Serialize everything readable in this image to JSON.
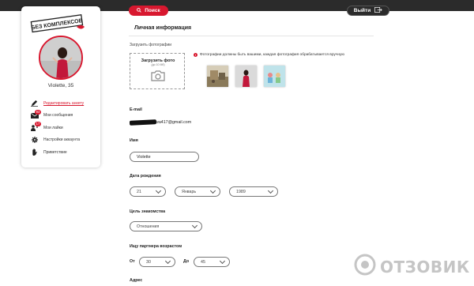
{
  "topbar": {
    "search_label": "Поиск",
    "logout_label": "Выйти"
  },
  "sidebar": {
    "logo_text": "БЕЗ КОМПЛЕКСОВ",
    "profile_name": "Violette, 35",
    "items": [
      {
        "label": "Редактировать анкету",
        "icon": "pencil-icon",
        "badge": ""
      },
      {
        "label": "Мои сообщения",
        "icon": "envelope-icon",
        "badge": "83"
      },
      {
        "label": "Мои лайки",
        "icon": "like-icon",
        "badge": "17"
      },
      {
        "label": "Настройки аккаунта",
        "icon": "gear-icon",
        "badge": ""
      },
      {
        "label": "Приветствие",
        "icon": "hand-icon",
        "badge": ""
      }
    ]
  },
  "main": {
    "section_title": "Личная информация",
    "upload_label": "Загрузить фотографии",
    "upload_box_title": "Загрузить фото",
    "upload_box_sub": "(до 10 Мб)",
    "photo_note": "Фотографии должны быть вашими, каждая фотография обрабатывается вручную",
    "email_label": "E-mail",
    "email_value": "wa417@gmail.com",
    "name_label": "Имя",
    "name_value": "Violette",
    "birth_label": "Дата рождения",
    "birth_day": "21",
    "birth_month": "Январь",
    "birth_year": "1989",
    "goal_label": "Цель знакомства",
    "goal_value": "Отношения",
    "partner_age_label": "Ищу партнера возрастом",
    "from_label": "От",
    "from_value": "30",
    "to_label": "До",
    "to_value": "45",
    "address_label": "Адрес"
  },
  "watermark": {
    "text": "ОТЗОВИК"
  },
  "colors": {
    "accent": "#d8182f",
    "topbar": "#2b2b2b"
  }
}
